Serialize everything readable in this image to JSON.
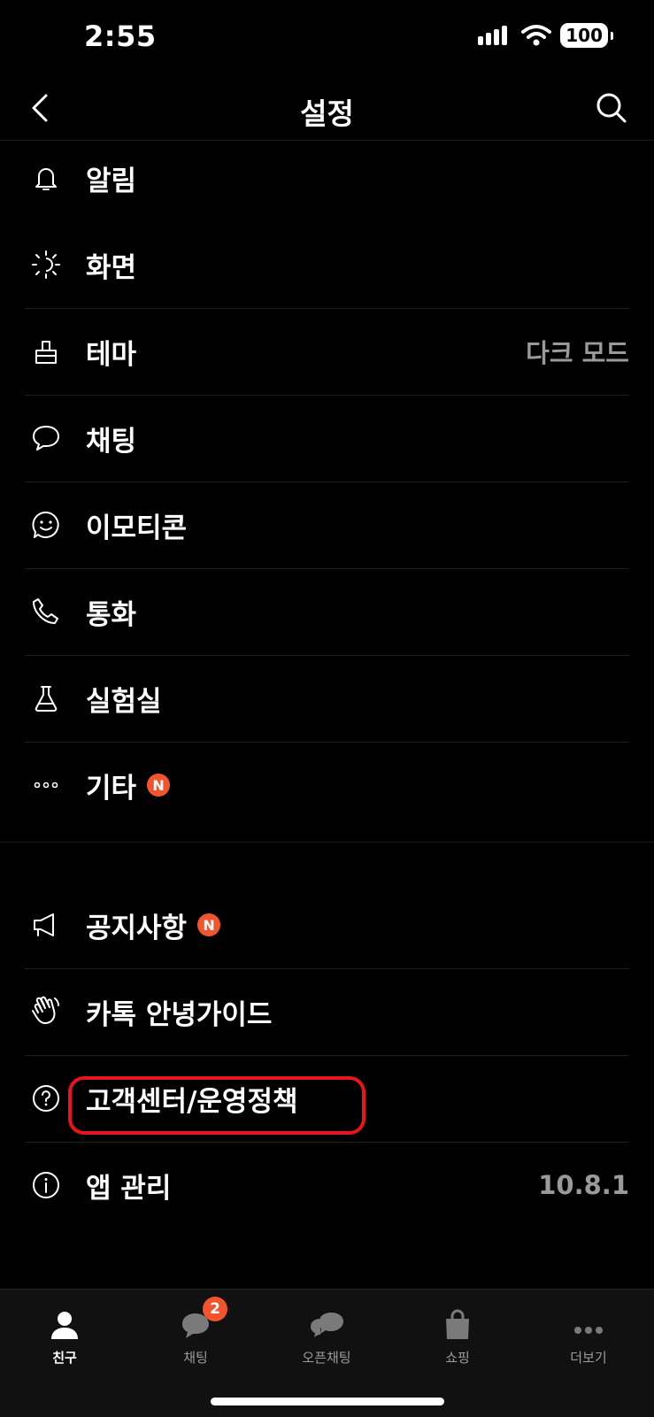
{
  "status": {
    "time": "2:55",
    "battery": "100"
  },
  "header": {
    "title": "설정"
  },
  "menu": {
    "group1": [
      {
        "icon": "bell-icon",
        "label": "알림"
      },
      {
        "icon": "brightness-icon",
        "label": "화면"
      },
      {
        "icon": "brush-icon",
        "label": "테마",
        "value": "다크 모드"
      },
      {
        "icon": "chat-bubble-icon",
        "label": "채팅"
      },
      {
        "icon": "emoticon-icon",
        "label": "이모티콘"
      },
      {
        "icon": "phone-icon",
        "label": "통화"
      },
      {
        "icon": "flask-icon",
        "label": "실험실"
      },
      {
        "icon": "more-dots-icon",
        "label": "기타",
        "badge": "N"
      }
    ],
    "group2": [
      {
        "icon": "megaphone-icon",
        "label": "공지사항",
        "badge": "N"
      },
      {
        "icon": "waving-hand-icon",
        "label": "카톡 안녕가이드"
      },
      {
        "icon": "question-circle-icon",
        "label": "고객센터/운영정책"
      },
      {
        "icon": "info-circle-icon",
        "label": "앱 관리",
        "value": "10.8.1"
      }
    ]
  },
  "tabs": [
    {
      "label": "친구",
      "icon": "person-icon",
      "active": true
    },
    {
      "label": "채팅",
      "icon": "chat-tab-icon",
      "badge": "2"
    },
    {
      "label": "오픈채팅",
      "icon": "open-chat-icon"
    },
    {
      "label": "쇼핑",
      "icon": "shopping-bag-icon"
    },
    {
      "label": "더보기",
      "icon": "more-tab-icon"
    }
  ]
}
